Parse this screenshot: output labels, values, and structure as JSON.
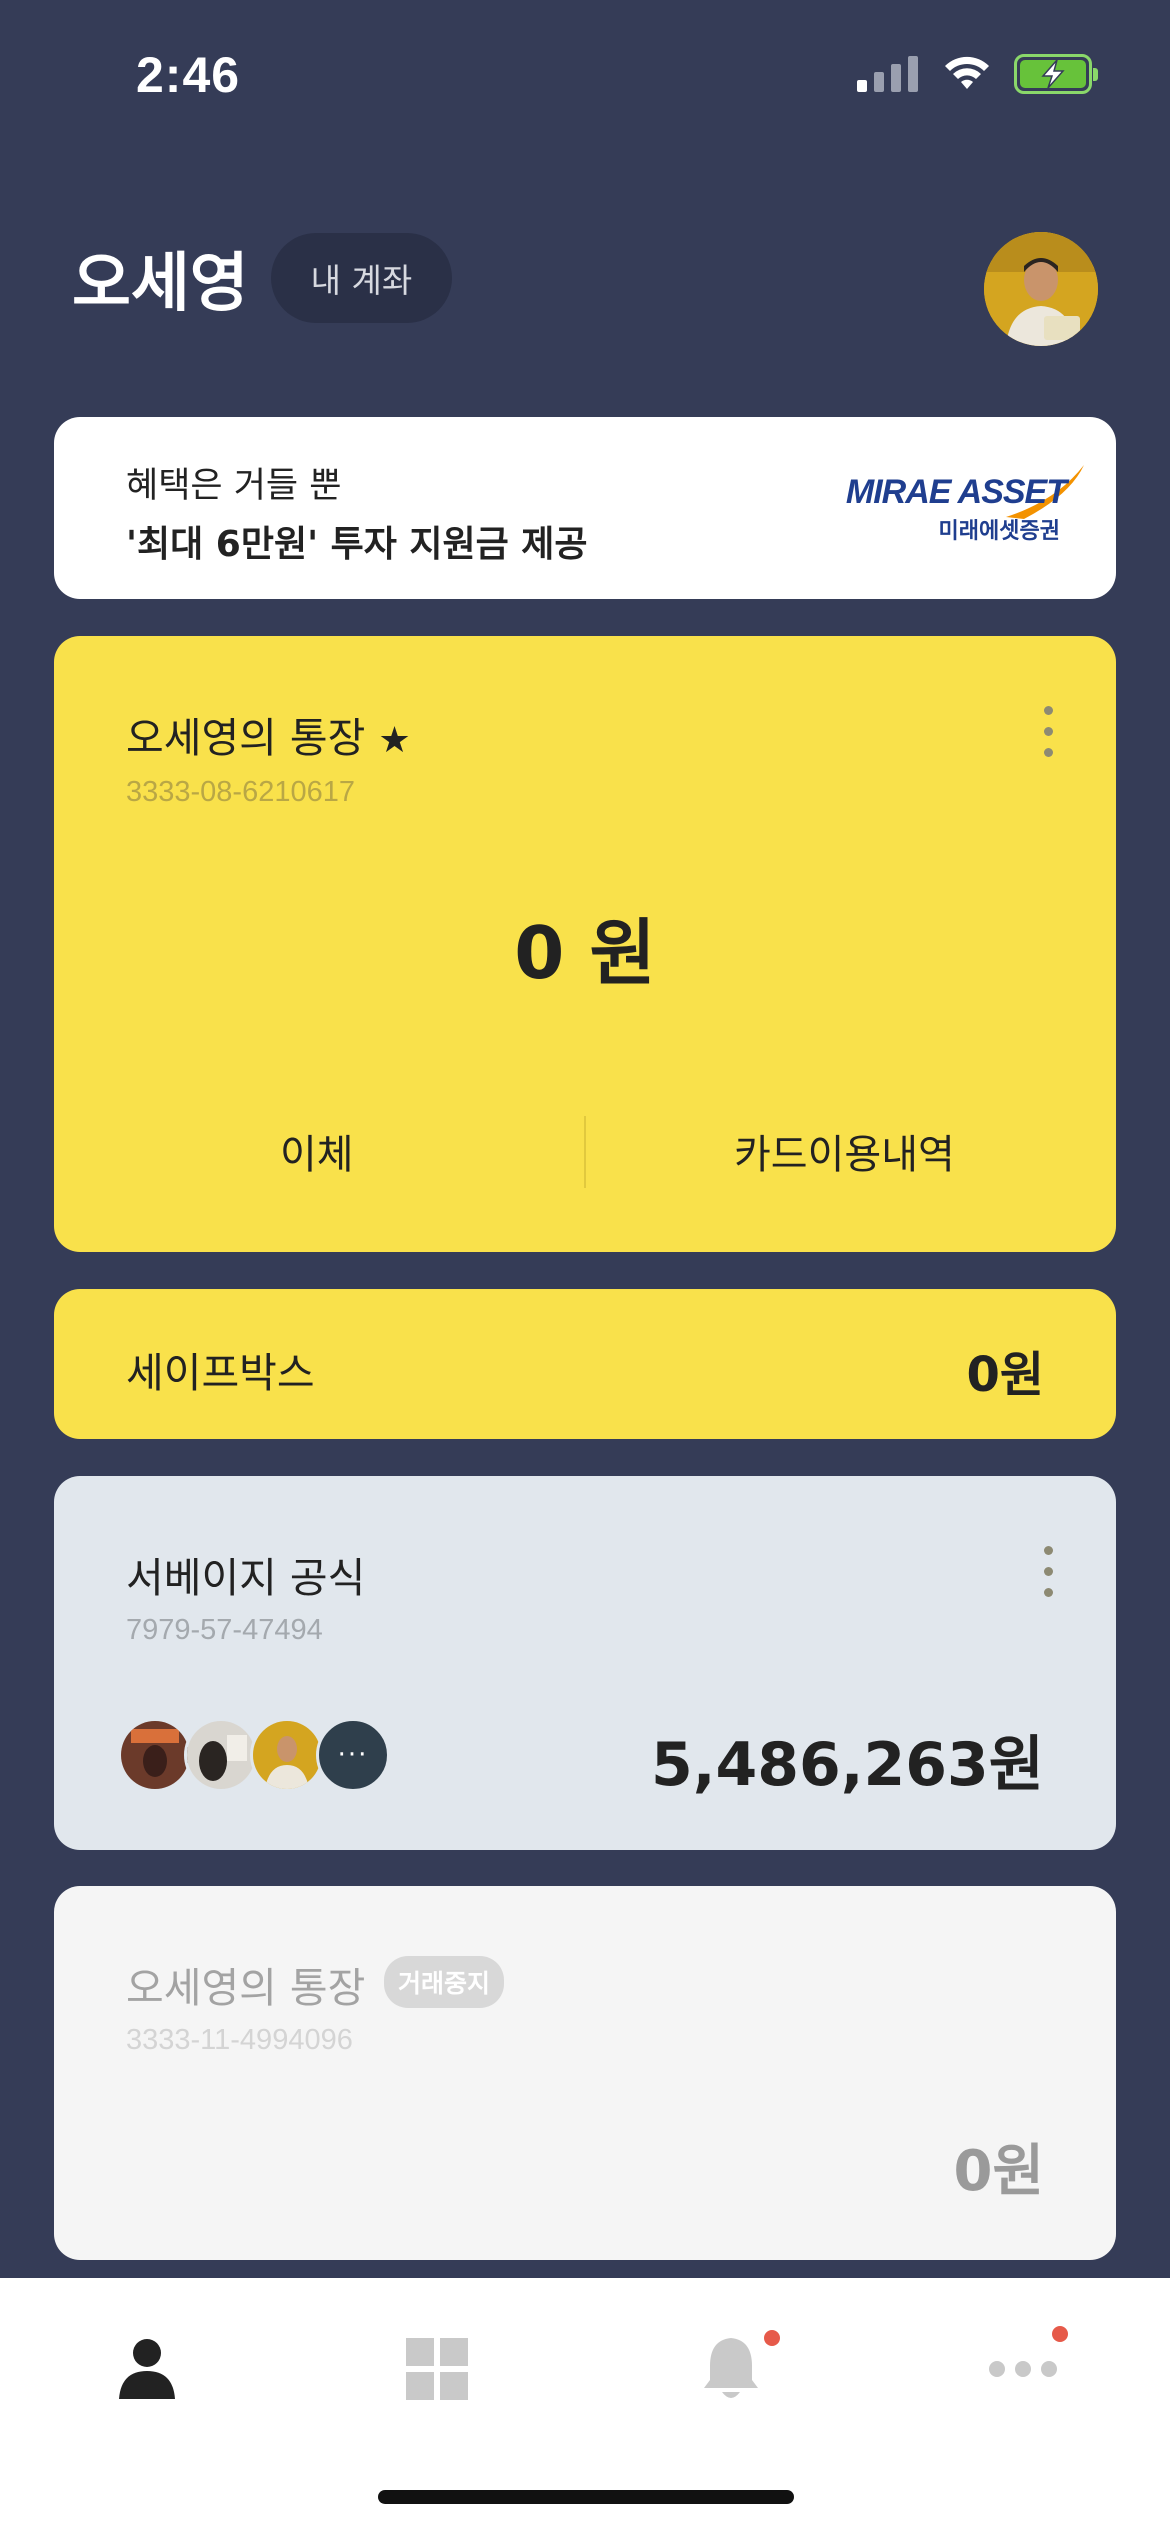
{
  "status_bar": {
    "time": "2:46"
  },
  "header": {
    "user_name": "오세영",
    "my_account_label": "내 계좌"
  },
  "banner": {
    "subtitle": "혜택은 거들 뿐",
    "title": "'최대 6만원' 투자 지원금 제공",
    "logo_en": "MIRAE ASSET",
    "logo_ko": "미래에셋증권"
  },
  "main_account": {
    "name": "오세영의 통장",
    "account_number": "3333-08-6210617",
    "balance": "0 원",
    "actions": [
      "이체",
      "카드이용내역"
    ],
    "accent_color": "#f9e14b"
  },
  "safebox": {
    "label": "세이프박스",
    "balance": "0원"
  },
  "group_account": {
    "name": "서베이지 공식",
    "account_number": "7979-57-47494",
    "balance": "5,486,263원",
    "members_more": "···"
  },
  "stopped_account": {
    "name": "오세영의 통장",
    "badge": "거래중지",
    "account_number": "3333-11-4994096",
    "balance": "0원"
  },
  "tab_bar": {
    "items": [
      "person-icon",
      "grid-icon",
      "bell-icon",
      "more-icon"
    ],
    "notification_color": "#e65a4a"
  }
}
